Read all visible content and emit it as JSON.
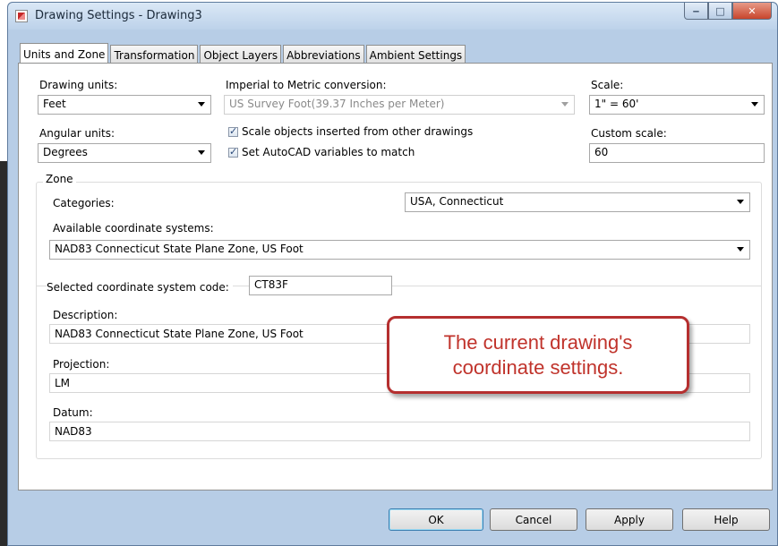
{
  "window": {
    "title": "Drawing Settings - Drawing3",
    "controls": {
      "minimize": "‒",
      "maximize": "□",
      "close": "✕"
    }
  },
  "tabs": [
    {
      "label": "Units and Zone",
      "active": true
    },
    {
      "label": "Transformation",
      "active": false
    },
    {
      "label": "Object Layers",
      "active": false
    },
    {
      "label": "Abbreviations",
      "active": false
    },
    {
      "label": "Ambient Settings",
      "active": false
    }
  ],
  "units": {
    "drawing_units_label": "Drawing units:",
    "drawing_units_value": "Feet",
    "conversion_label": "Imperial to Metric conversion:",
    "conversion_value": "US Survey Foot(39.37 Inches per Meter)",
    "scale_label": "Scale:",
    "scale_value": "1\" = 60'",
    "angular_label": "Angular units:",
    "angular_value": "Degrees",
    "scale_objects_label": "Scale objects inserted from other drawings",
    "set_vars_label": "Set AutoCAD variables to match",
    "custom_scale_label": "Custom scale:",
    "custom_scale_value": "60"
  },
  "zone": {
    "group_title": "Zone",
    "categories_label": "Categories:",
    "categories_value": "USA, Connecticut",
    "available_label": "Available coordinate systems:",
    "available_value": "NAD83 Connecticut State Plane Zone, US Foot",
    "code_label": "Selected coordinate system code:",
    "code_value": "CT83F",
    "description_label": "Description:",
    "description_value": "NAD83 Connecticut State Plane Zone, US Foot",
    "projection_label": "Projection:",
    "projection_value": "LM",
    "datum_label": "Datum:",
    "datum_value": "NAD83"
  },
  "callout": {
    "text": "The current drawing's\ncoordinate settings."
  },
  "buttons": {
    "ok": "OK",
    "cancel": "Cancel",
    "apply": "Apply",
    "help": "Help"
  },
  "colors": {
    "callout_border": "#b52f2f",
    "callout_text": "#c0332b",
    "close_button": "#c8452c"
  }
}
